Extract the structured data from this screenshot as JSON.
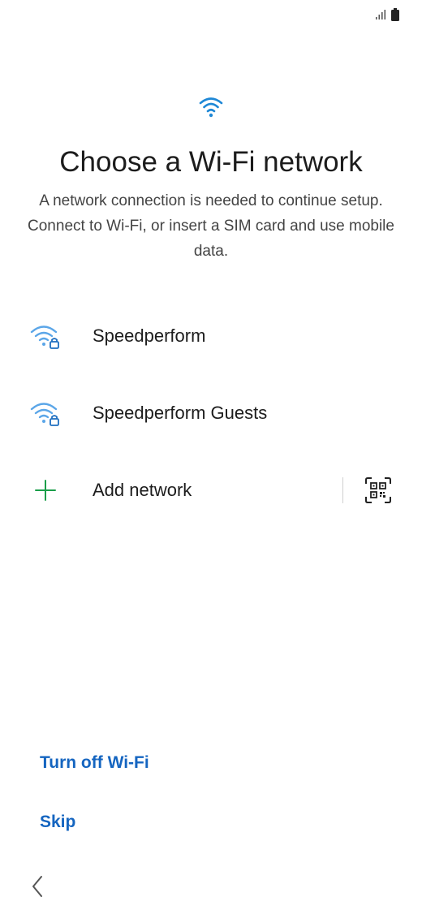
{
  "status_bar": {
    "icons": [
      "signal-icon",
      "battery-icon"
    ]
  },
  "header": {
    "icon": "wifi-icon",
    "title": "Choose a Wi-Fi network",
    "subtitle": "A network connection is needed to continue setup. Connect to Wi-Fi, or insert a SIM card and use mobile data."
  },
  "networks": [
    {
      "name": "Speedperform",
      "icon": "wifi-lock-icon"
    },
    {
      "name": "Speedperform Guests",
      "icon": "wifi-lock-icon"
    }
  ],
  "add_network": {
    "label": "Add network",
    "icon": "plus-icon",
    "qr_icon": "qr-scan-icon"
  },
  "actions": {
    "turn_off_wifi": "Turn off Wi-Fi",
    "skip": "Skip"
  },
  "nav": {
    "back_icon": "back-chevron-icon"
  },
  "colors": {
    "accent": "#1565c0",
    "wifi_icon": "#1f88d6",
    "plus": "#1a9e4a"
  }
}
